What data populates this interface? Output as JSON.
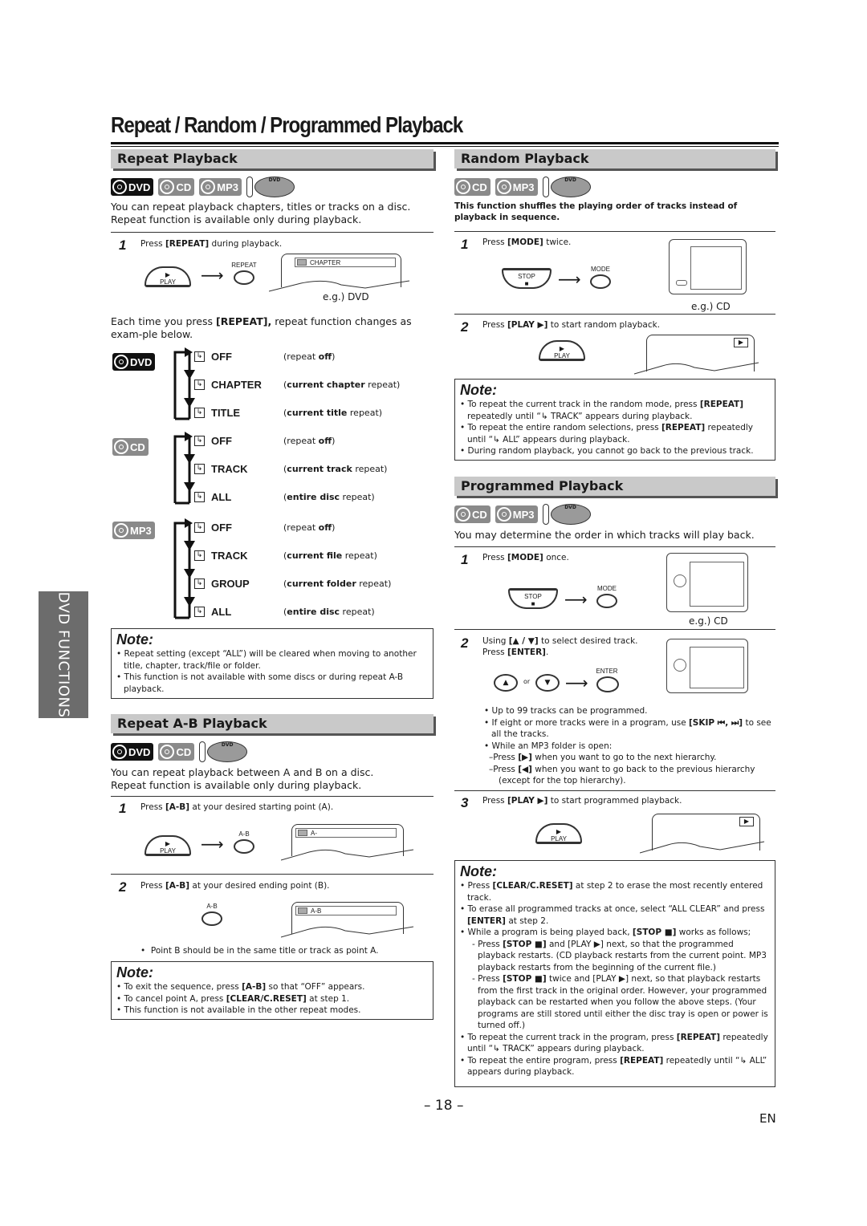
{
  "page": {
    "title": "Repeat / Random / Programmed Playback",
    "side_tab": "DVD FUNCTIONS",
    "page_number": "– 18 –",
    "language": "EN"
  },
  "badges": {
    "dvd": "DVD",
    "cd": "CD",
    "mp3": "MP3",
    "remote_dvd": "DVD"
  },
  "repeat": {
    "heading": "Repeat Playback",
    "intro_1": "You can repeat playback chapters, titles or tracks on a disc.",
    "intro_2": "Repeat function is available only during playback.",
    "step1": {
      "num": "1",
      "pre": "Press ",
      "key": "[REPEAT]",
      "post": " during playback.",
      "play_btn": "PLAY",
      "play_sym": "▶",
      "repeat_btn": "REPEAT",
      "osd": "CHAPTER",
      "eg": "e.g.) DVD"
    },
    "each_time_pre": "Each time you press ",
    "each_time_key": "[REPEAT],",
    "each_time_post": " repeat function changes as exam-ple below.",
    "repeat_icon": "↳",
    "groups": [
      {
        "badge": "DVD",
        "items": [
          {
            "label": "OFF",
            "desc_bold": "",
            "desc_pre": "(repeat ",
            "desc_b": "off",
            "desc_post": ")"
          },
          {
            "label": "CHAPTER",
            "desc_pre": "(",
            "desc_b": "current chapter",
            "desc_post": " repeat)"
          },
          {
            "label": "TITLE",
            "desc_pre": "(",
            "desc_b": "current title",
            "desc_post": " repeat)"
          }
        ]
      },
      {
        "badge": "CD",
        "items": [
          {
            "label": "OFF",
            "desc_pre": "(repeat ",
            "desc_b": "off",
            "desc_post": ")"
          },
          {
            "label": "TRACK",
            "desc_pre": "(",
            "desc_b": "current track",
            "desc_post": " repeat)"
          },
          {
            "label": "ALL",
            "desc_pre": "(",
            "desc_b": "entire disc",
            "desc_post": " repeat)"
          }
        ]
      },
      {
        "badge": "MP3",
        "items": [
          {
            "label": "OFF",
            "desc_pre": "(repeat ",
            "desc_b": "off",
            "desc_post": ")"
          },
          {
            "label": "TRACK",
            "desc_pre": "(",
            "desc_b": "current file",
            "desc_post": " repeat)"
          },
          {
            "label": "GROUP",
            "desc_pre": "(",
            "desc_b": "current folder",
            "desc_post": " repeat)"
          },
          {
            "label": "ALL",
            "desc_pre": "(",
            "desc_b": "entire disc",
            "desc_post": " repeat)"
          }
        ]
      }
    ],
    "note": {
      "title": "Note:",
      "items": [
        "Repeat setting (except “ALL”) will be cleared when moving to another title, chapter, track/file or folder.",
        "This function is not available with some discs or during repeat A-B playback."
      ]
    }
  },
  "ab": {
    "heading": "Repeat A-B Playback",
    "intro_1": "You can repeat playback between A and B on a disc.",
    "intro_2": "Repeat function is available only during playback.",
    "step1": {
      "num": "1",
      "pre": "Press ",
      "key": "[A-B]",
      "post": " at your desired starting point (A).",
      "play_btn": "PLAY",
      "play_sym": "▶",
      "ab_btn": "A-B",
      "osd": "A-"
    },
    "step2": {
      "num": "2",
      "pre": "Press ",
      "key": "[A-B]",
      "post": " at your desired ending point (B).",
      "ab_btn": "A-B",
      "osd": "A-B",
      "bullet": "Point B should be in the same title or track as point A."
    },
    "note": {
      "title": "Note:",
      "items": [
        {
          "pre": "To exit the sequence, press ",
          "b": "[A-B]",
          "post": " so that “OFF” appears."
        },
        {
          "pre": "To cancel point A, press ",
          "b": "[CLEAR/C.RESET]",
          "post": " at step 1."
        },
        {
          "pre": "This function is not available in the other repeat modes.",
          "b": "",
          "post": ""
        }
      ]
    }
  },
  "random": {
    "heading": "Random Playback",
    "intro": "This function shuffles the playing order of tracks instead of playback in sequence.",
    "step1": {
      "num": "1",
      "pre": "Press ",
      "key": "[MODE]",
      "post": " twice.",
      "stop_btn": "STOP",
      "stop_sym": "■",
      "mode_btn": "MODE",
      "eg": "e.g.) CD"
    },
    "step2": {
      "num": "2",
      "pre": "Press ",
      "key": "[PLAY ▶]",
      "post": " to start random playback.",
      "play_btn": "PLAY",
      "play_sym": "▶",
      "osd_play": "▶"
    },
    "note": {
      "title": "Note:",
      "items": [
        {
          "pre": "To repeat the current track in the random mode, press ",
          "b": "[REPEAT]",
          "post": " repeatedly until “↳ TRACK” appears during playback."
        },
        {
          "pre": "To repeat the entire random selections, press ",
          "b": "[REPEAT]",
          "post": " repeatedly until “↳ ALL” appears during playback."
        },
        {
          "pre": "During random playback, you cannot go back to the previous track.",
          "b": "",
          "post": ""
        }
      ]
    }
  },
  "program": {
    "heading": "Programmed Playback",
    "intro": "You may determine the order in which tracks will play back.",
    "step1": {
      "num": "1",
      "pre": "Press ",
      "key": "[MODE]",
      "post": " once.",
      "stop_btn": "STOP",
      "stop_sym": "■",
      "mode_btn": "MODE",
      "eg": "e.g.) CD"
    },
    "step2": {
      "num": "2",
      "pre": "Using ",
      "key": "[▲ / ▼]",
      "post": " to select desired track.",
      "line2_pre": "Press ",
      "line2_key": "[ENTER]",
      "line2_post": ".",
      "up_sym": "▲",
      "or": "or",
      "down_sym": "▼",
      "enter_btn": "ENTER"
    },
    "bullets": [
      {
        "pre": "Up to 99 tracks can be programmed.",
        "b": "",
        "post": "",
        "sub": false
      },
      {
        "pre": "If eight or more tracks were in a program, use ",
        "b": "[SKIP ⏮, ⏭]",
        "post": " to see all the tracks.",
        "sub": false
      },
      {
        "pre": "While an MP3 folder is open:",
        "b": "",
        "post": "",
        "sub": false
      },
      {
        "pre": "–Press ",
        "b": "[▶]",
        "post": " when you want to go to the next hierarchy.",
        "sub": true
      },
      {
        "pre": "–Press ",
        "b": "[◀]",
        "post": " when you want to go back to the previous hierarchy (except for the top hierarchy).",
        "sub": true
      }
    ],
    "step3": {
      "num": "3",
      "pre": "Press ",
      "key": "[PLAY ▶]",
      "post": " to start programmed playback.",
      "play_btn": "PLAY",
      "play_sym": "▶",
      "osd_play": "▶"
    },
    "note": {
      "title": "Note:",
      "items": [
        {
          "pre": "Press ",
          "b": "[CLEAR/C.RESET]",
          "post": " at step 2 to erase the most recently entered track.",
          "sub": false
        },
        {
          "pre": "To erase all programmed tracks at once, select “ALL CLEAR” and press ",
          "b": "[ENTER]",
          "post": " at step 2.",
          "sub": false
        },
        {
          "pre": "While a program is being played back, ",
          "b": "[STOP ■]",
          "post": " works as follows;",
          "sub": false
        },
        {
          "pre": "Press ",
          "b": "[STOP ■]",
          "post": " and [PLAY ▶] next, so that the programmed playback restarts. (CD playback restarts from the current point. MP3 playback restarts from the beginning of the current file.)",
          "sub": true
        },
        {
          "pre": "Press ",
          "b": "[STOP ■]",
          "post": " twice and [PLAY ▶] next, so that playback restarts from the first track in the original order. However, your programmed playback can be restarted when you follow the above steps. (Your programs are still stored until either the disc tray is open or power is turned off.)",
          "sub": true
        },
        {
          "pre": "To repeat the current track in the program, press ",
          "b": "[REPEAT]",
          "post": " repeatedly until “↳ TRACK” appears during playback.",
          "sub": false
        },
        {
          "pre": "To repeat the entire program, press ",
          "b": "[REPEAT]",
          "post": " repeatedly until “↳ ALL” appears during playback.",
          "sub": false
        }
      ]
    }
  }
}
